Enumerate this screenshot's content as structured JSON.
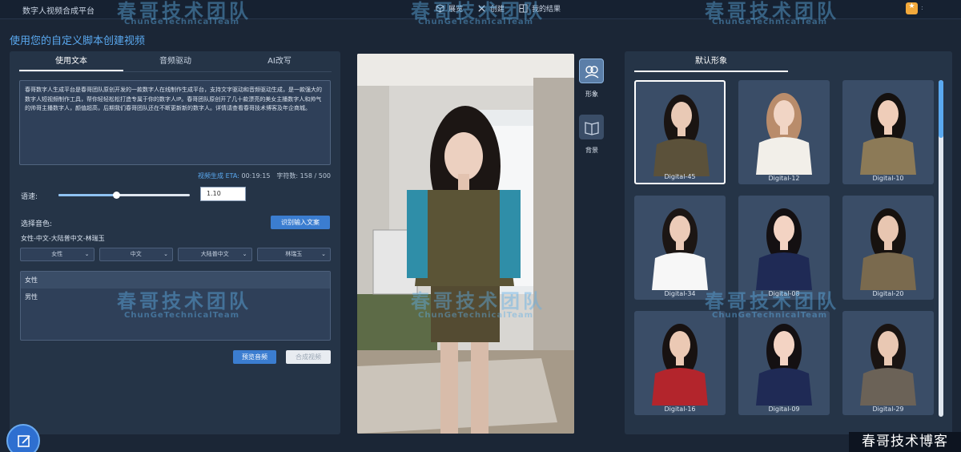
{
  "app": {
    "title": "数字人视频合成平台"
  },
  "nav": {
    "items": [
      {
        "label": "展览",
        "icon": "cube-icon"
      },
      {
        "label": "创建",
        "icon": "tools-icon"
      },
      {
        "label": "我的结果",
        "icon": "results-icon"
      }
    ]
  },
  "page": {
    "title": "使用您的自定义脚本创建视频"
  },
  "left": {
    "tabs": [
      "使用文本",
      "音频驱动",
      "AI改写"
    ],
    "active_tab": "使用文本",
    "script_text": "春哥数字人生成平台是春哥团队原创开发的一款数字人在线制作生成平台，支持文字驱动和音频驱动生成，是一款强大的数字人短视频制作工具，帮你轻轻松松打造专属于你的数字人IP。春哥团队原创开了几十款漂亮的美女主播数字人和帅气的帅哥主播数字人，颜值超高，后期我们春哥团队还在不断更新新的数字人。详情请查看春哥技术博客及年企商城。",
    "eta_label": "视频生成 ETA:",
    "eta_value": "00:19:15",
    "char_count_label": "字符数:",
    "char_count": "158 / 500",
    "speed_label": "语速:",
    "speed_value": "1.10",
    "speed_fraction": 0.44,
    "voice_label": "选择音色:",
    "recognize_button": "识别输入文案",
    "voice_summary": "女性-中文-大陆普中文-林瑞玉",
    "selects": [
      "女性",
      "中文",
      "大陆普中文",
      "林瑞玉"
    ],
    "gender_options": [
      "女性",
      "男性"
    ],
    "preview_button": "预览音频",
    "compose_button": "合成视频"
  },
  "tools": [
    {
      "label": "形象",
      "icon": "avatar-group-icon"
    },
    {
      "label": "背景",
      "icon": "book-icon"
    }
  ],
  "right": {
    "tab": "默认形象",
    "avatars": [
      {
        "name": "Digital-45",
        "hair": "#1a1412",
        "top": "#5b513a",
        "skin": "#e9c9b5"
      },
      {
        "name": "Digital-12",
        "hair": "#b98c6b",
        "top": "#f2efe9",
        "skin": "#f1d5c5"
      },
      {
        "name": "Digital-10",
        "hair": "#15110f",
        "top": "#8c7a57",
        "skin": "#efcdb9"
      },
      {
        "name": "Digital-34",
        "hair": "#1c1614",
        "top": "#f7f7f7",
        "skin": "#eccbb8"
      },
      {
        "name": "Digital-08",
        "hair": "#141012",
        "top": "#1f2a55",
        "skin": "#f3d3c3"
      },
      {
        "name": "Digital-20",
        "hair": "#17120f",
        "top": "#7a6a4e",
        "skin": "#e8c6b1"
      },
      {
        "name": "Digital-16",
        "hair": "#181211",
        "top": "#b3252c",
        "skin": "#ebc9b4"
      },
      {
        "name": "Digital-09",
        "hair": "#141012",
        "top": "#1f2a55",
        "skin": "#f3d3c3"
      },
      {
        "name": "Digital-29",
        "hair": "#1a1412",
        "top": "#6b6257",
        "skin": "#e9c8b3"
      }
    ]
  },
  "watermark": {
    "cn": "春哥技术团队",
    "en": "ChunGeTechnicalTeam"
  },
  "blog_tag": "春哥技术博客",
  "colors": {
    "accent": "#3b7dd0",
    "link": "#5aa9f0",
    "bg": "#1b2636",
    "panel": "#253447"
  }
}
